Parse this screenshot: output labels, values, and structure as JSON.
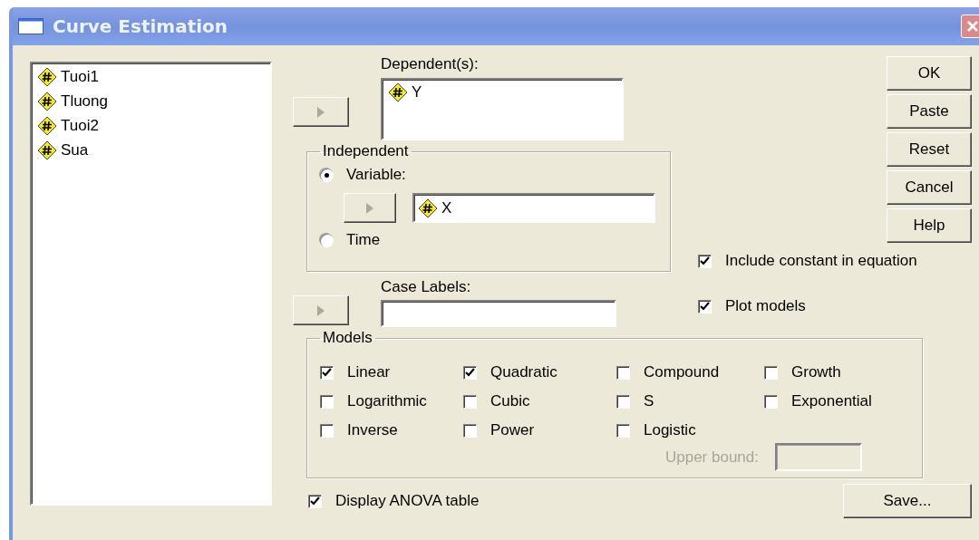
{
  "window": {
    "title": "Curve Estimation"
  },
  "variables": [
    {
      "name": "Tuoi1"
    },
    {
      "name": "Tluong"
    },
    {
      "name": "Tuoi2"
    },
    {
      "name": "Sua"
    }
  ],
  "dependent": {
    "label": "Dependent(s):",
    "items": [
      "Y"
    ],
    "move_disabled": true
  },
  "independent": {
    "title": "Independent",
    "options": [
      {
        "label": "Variable:",
        "selected": true
      },
      {
        "label": "Time",
        "selected": false
      }
    ],
    "variable": "X",
    "move_disabled": true
  },
  "case_labels": {
    "label": "Case Labels:",
    "move_disabled": true
  },
  "buttons": [
    "OK",
    "Paste",
    "Reset",
    "Cancel",
    "Help"
  ],
  "options": [
    {
      "label": "Include constant in equation",
      "checked": true
    },
    {
      "label": "Plot models",
      "checked": true
    }
  ],
  "models": {
    "title": "Models",
    "items": [
      {
        "label": "Linear",
        "checked": true
      },
      {
        "label": "Quadratic",
        "checked": true
      },
      {
        "label": "Compound",
        "checked": false
      },
      {
        "label": "Growth",
        "checked": false
      },
      {
        "label": "Logarithmic",
        "checked": false
      },
      {
        "label": "Cubic",
        "checked": false
      },
      {
        "label": "S",
        "checked": false
      },
      {
        "label": "Exponential",
        "checked": false
      },
      {
        "label": "Inverse",
        "checked": false
      },
      {
        "label": "Power",
        "checked": false
      },
      {
        "label": "Logistic",
        "checked": false
      }
    ],
    "upper_bound": {
      "label": "Upper bound:",
      "disabled": true
    }
  },
  "display_anova": {
    "label": "Display ANOVA table",
    "checked": true
  },
  "save_button": "Save..."
}
